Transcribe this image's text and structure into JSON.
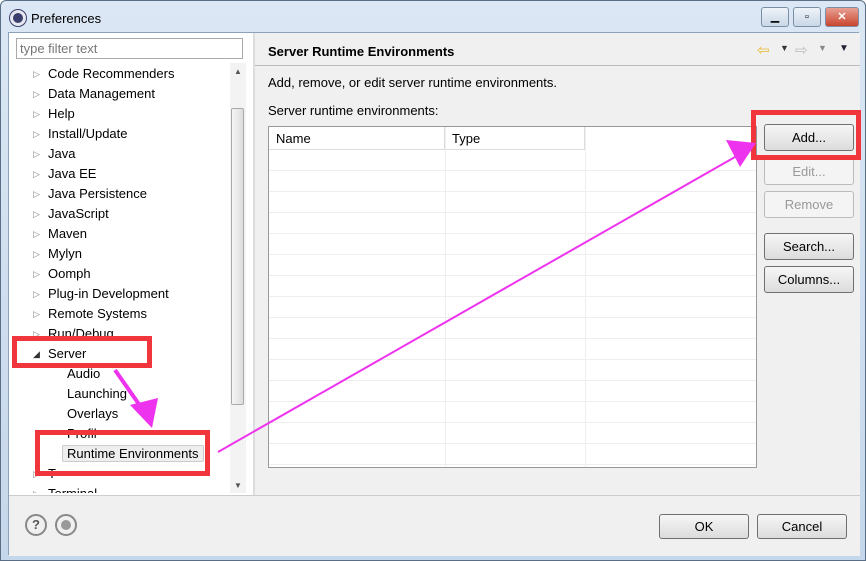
{
  "window": {
    "title": "Preferences",
    "controls": [
      "minimize",
      "maximize",
      "close"
    ]
  },
  "filter": {
    "placeholder": "type filter text"
  },
  "tree": {
    "items": [
      {
        "label": "Code Recommenders",
        "level": 0,
        "expanded": false
      },
      {
        "label": "Data Management",
        "level": 0,
        "expanded": false
      },
      {
        "label": "Help",
        "level": 0,
        "expanded": false
      },
      {
        "label": "Install/Update",
        "level": 0,
        "expanded": false
      },
      {
        "label": "Java",
        "level": 0,
        "expanded": false
      },
      {
        "label": "Java EE",
        "level": 0,
        "expanded": false
      },
      {
        "label": "Java Persistence",
        "level": 0,
        "expanded": false
      },
      {
        "label": "JavaScript",
        "level": 0,
        "expanded": false
      },
      {
        "label": "Maven",
        "level": 0,
        "expanded": false
      },
      {
        "label": "Mylyn",
        "level": 0,
        "expanded": false
      },
      {
        "label": "Oomph",
        "level": 0,
        "expanded": false
      },
      {
        "label": "Plug-in Development",
        "level": 0,
        "expanded": false
      },
      {
        "label": "Remote Systems",
        "level": 0,
        "expanded": false
      },
      {
        "label": "Run/Debug",
        "level": 0,
        "expanded": false
      },
      {
        "label": "Server",
        "level": 0,
        "expanded": true
      },
      {
        "label": "Audio",
        "level": 1
      },
      {
        "label": "Launching",
        "level": 1
      },
      {
        "label": "Overlays",
        "level": 1
      },
      {
        "label": "Profil",
        "level": 1
      },
      {
        "label": "Runtime Environments",
        "level": 1,
        "selected": true
      },
      {
        "label": "T",
        "level": 0,
        "expanded": false
      },
      {
        "label": "Terminal",
        "level": 0,
        "expanded": false
      }
    ]
  },
  "page": {
    "title": "Server Runtime Environments",
    "description": "Add, remove, or edit server runtime environments.",
    "list_label": "Server runtime environments:",
    "columns": [
      "Name",
      "Type"
    ],
    "rows": []
  },
  "buttons": {
    "add": "Add...",
    "edit": "Edit...",
    "remove": "Remove",
    "search": "Search...",
    "columns": "Columns..."
  },
  "footer": {
    "ok": "OK",
    "cancel": "Cancel",
    "help_icon": "?"
  },
  "annotation_colors": {
    "box": "#f0353d",
    "arrow": "#ee33ee"
  }
}
